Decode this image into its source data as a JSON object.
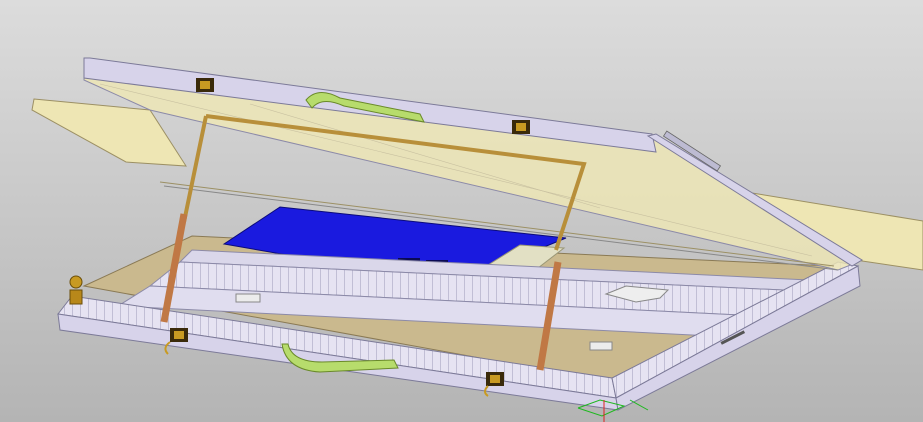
{
  "viewport": {
    "background_top": "#dcdcdc",
    "background_bottom": "#b4b4b4"
  },
  "model": {
    "colors": {
      "frame_face": "#d7d3ea",
      "frame_edge": "#8c8aa8",
      "panel_tan": "#eee6b4",
      "panel_tan_edge": "#9c9064",
      "base_floor": "#cab98e",
      "board_blue": "#1a1adf",
      "strap_green": "#b7dc6c",
      "rod_brown": "#c07845",
      "rod_gold": "#b88f3a",
      "latch_gold": "#c89a22"
    },
    "icons": [
      "latch-icon",
      "handle-icon",
      "thumbscrew-icon",
      "axis-triad-icon"
    ]
  }
}
